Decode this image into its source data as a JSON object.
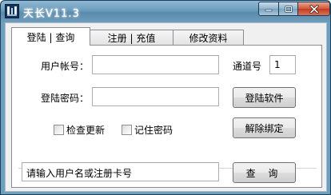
{
  "window": {
    "title": "天长V11.3",
    "controls": {
      "minimize": "minimize-icon",
      "maximize": "maximize-icon",
      "close": "close-icon"
    }
  },
  "tabs": [
    {
      "label": "登陆 | 查询",
      "active": true
    },
    {
      "label": "注册 | 充值",
      "active": false
    },
    {
      "label": "修改资料",
      "active": false
    }
  ],
  "login_form": {
    "account_label": "用户帐号：",
    "account_value": "",
    "password_label": "登陆密码：",
    "password_value": "",
    "channel_label": "通道号",
    "channel_value": "1",
    "login_button": "登陆软件",
    "unbind_button": "解除绑定",
    "check_update_label": "检查更新",
    "check_update_checked": false,
    "remember_password_label": "记住密码",
    "remember_password_checked": false
  },
  "query": {
    "input_value": "请输入用户名或注册卡号",
    "button_label": "查 询"
  },
  "colors": {
    "title_bar": "#6f9fbe",
    "close_button": "#c94a2e",
    "panel_background": "#ffffff",
    "window_background": "#f0f0f0"
  }
}
